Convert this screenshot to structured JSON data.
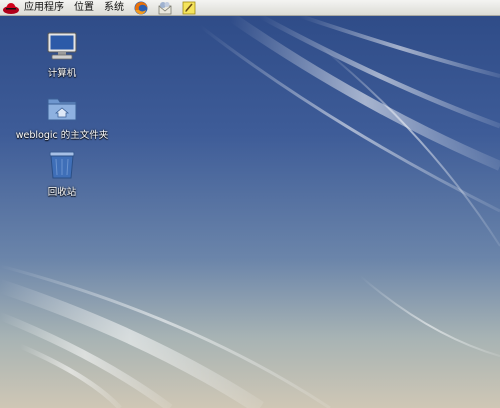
{
  "panel": {
    "menus": [
      "应用程序",
      "位置",
      "系统"
    ],
    "launchers": [
      "firefox-icon",
      "evolution-mail-icon",
      "notes-icon"
    ],
    "logo_icon": "redhat-logo-icon"
  },
  "desktop": {
    "icons": [
      {
        "label": "计算机",
        "icon": "computer-icon"
      },
      {
        "label": "weblogic 的主文件夹",
        "icon": "home-folder-icon"
      },
      {
        "label": "回收站",
        "icon": "trash-icon"
      }
    ]
  }
}
